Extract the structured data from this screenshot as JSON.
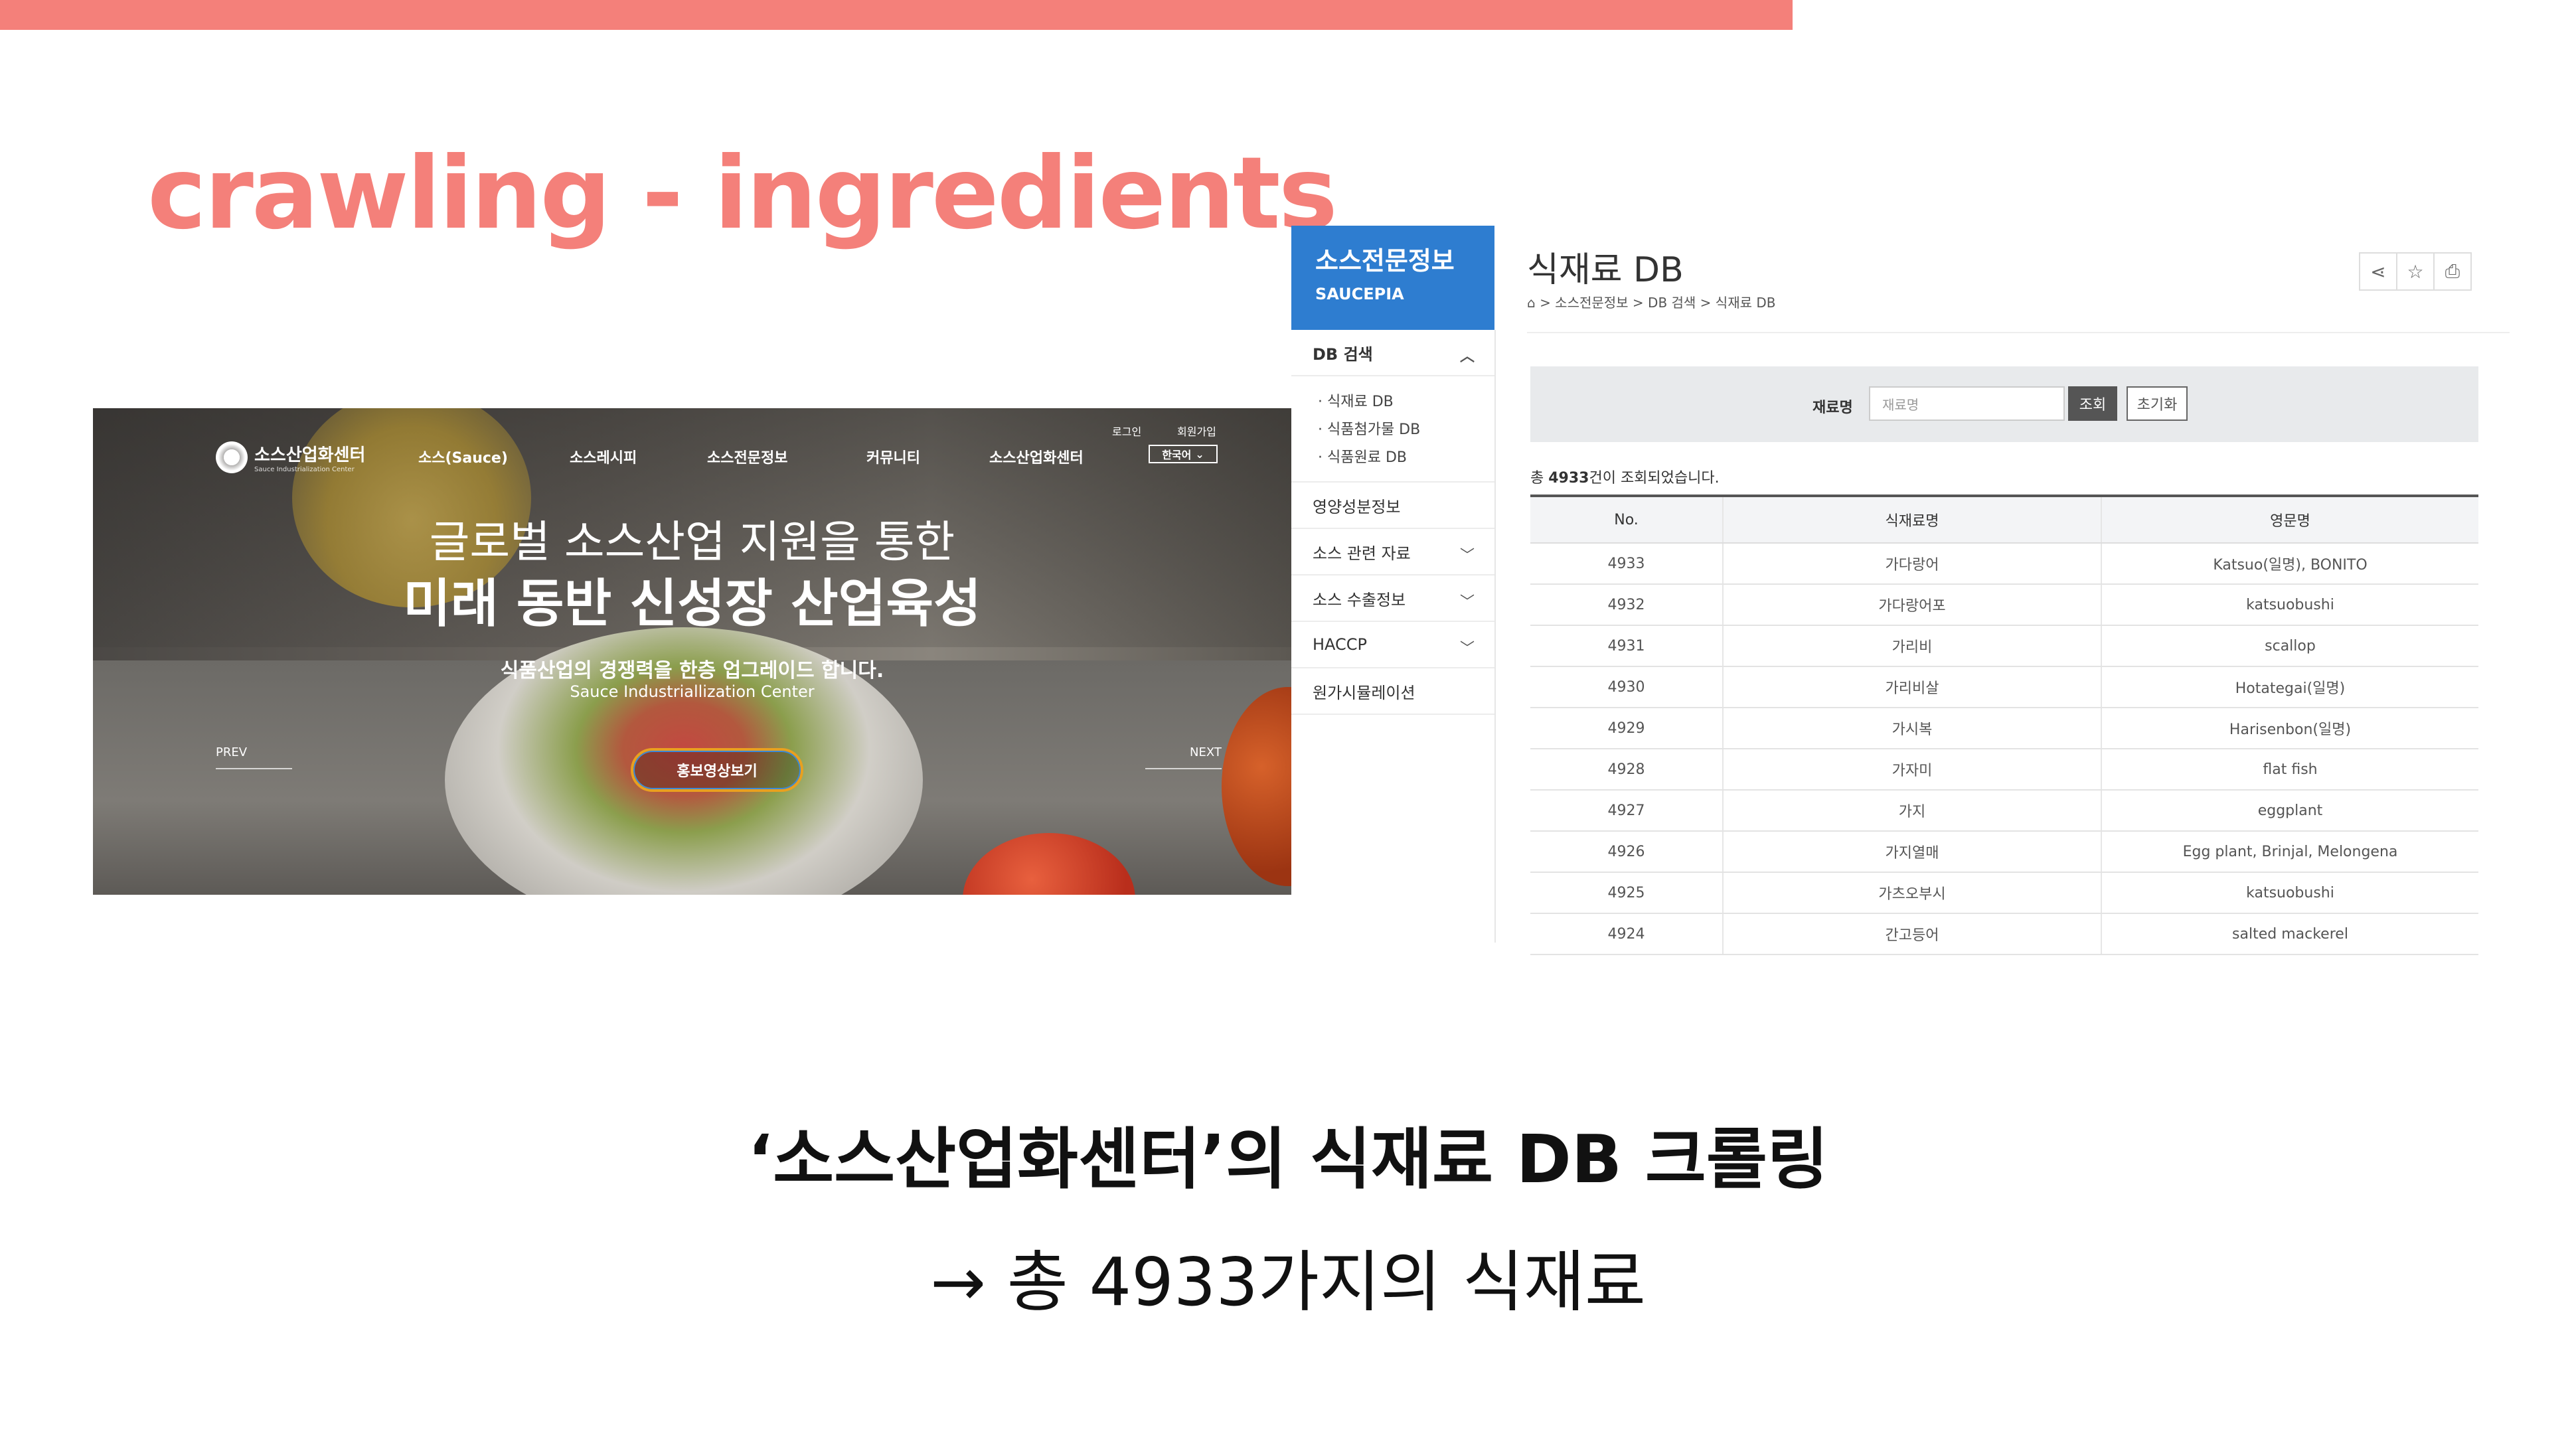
{
  "slide": {
    "title": "crawling - ingredients",
    "caption_line1": "‘소스산업화센터’의 식재료 DB 크롤링",
    "caption_line2": "→ 총 4933가지의 식재료"
  },
  "hero": {
    "logo_name": "소스산업화센터",
    "logo_sub": "Sauce Industrialization Center",
    "nav": [
      "소스(Sauce)",
      "소스레시피",
      "소스전문정보",
      "커뮤니티",
      "소스산업화센터"
    ],
    "login": "로그인",
    "signup": "회원가입",
    "language": "한국어",
    "headline1": "글로벌 소스산업 지원을 통한",
    "headline2": "미래 동반 신성장 산업육성",
    "sub_strong": "식품산업의 경쟁력을 한층 업그레이드 합니다.",
    "sub_en": "Sauce Industriallization Center",
    "video_button": "홍보영상보기",
    "prev": "PREV",
    "next": "NEXT"
  },
  "db": {
    "brand": "소스전문정보",
    "brand_en": "SAUCEPIA",
    "page_title": "식재료 DB",
    "breadcrumb": "> 소스전문정보 > DB 검색 > 식재료 DB",
    "sidebar": {
      "section": "DB 검색",
      "sub_items": [
        "· 식재료 DB",
        "· 식품첨가물 DB",
        "· 식품원료 DB"
      ],
      "items": [
        "영양성분정보",
        "소스 관련 자료",
        "소스 수출정보",
        "HACCP",
        "원가시뮬레이션"
      ]
    },
    "search": {
      "label": "재료명",
      "placeholder": "재료명",
      "search_button": "조회",
      "reset_button": "초기화"
    },
    "count_prefix": "총 ",
    "count_value": "4933",
    "count_suffix": "건이 조회되었습니다.",
    "table": {
      "headers": [
        "No.",
        "식재료명",
        "영문명"
      ],
      "rows": [
        [
          "4933",
          "가다랑어",
          "Katsuo(일명), BONITO"
        ],
        [
          "4932",
          "가다랑어포",
          "katsuobushi"
        ],
        [
          "4931",
          "가리비",
          "scallop"
        ],
        [
          "4930",
          "가리비살",
          "Hotategai(일명)"
        ],
        [
          "4929",
          "가시복",
          "Harisenbon(일명)"
        ],
        [
          "4928",
          "가자미",
          "flat fish"
        ],
        [
          "4927",
          "가지",
          "eggplant"
        ],
        [
          "4926",
          "가지열매",
          "Egg plant, Brinjal, Melongena"
        ],
        [
          "4925",
          "가츠오부시",
          "katsuobushi"
        ],
        [
          "4924",
          "간고등어",
          "salted mackerel"
        ]
      ]
    }
  }
}
